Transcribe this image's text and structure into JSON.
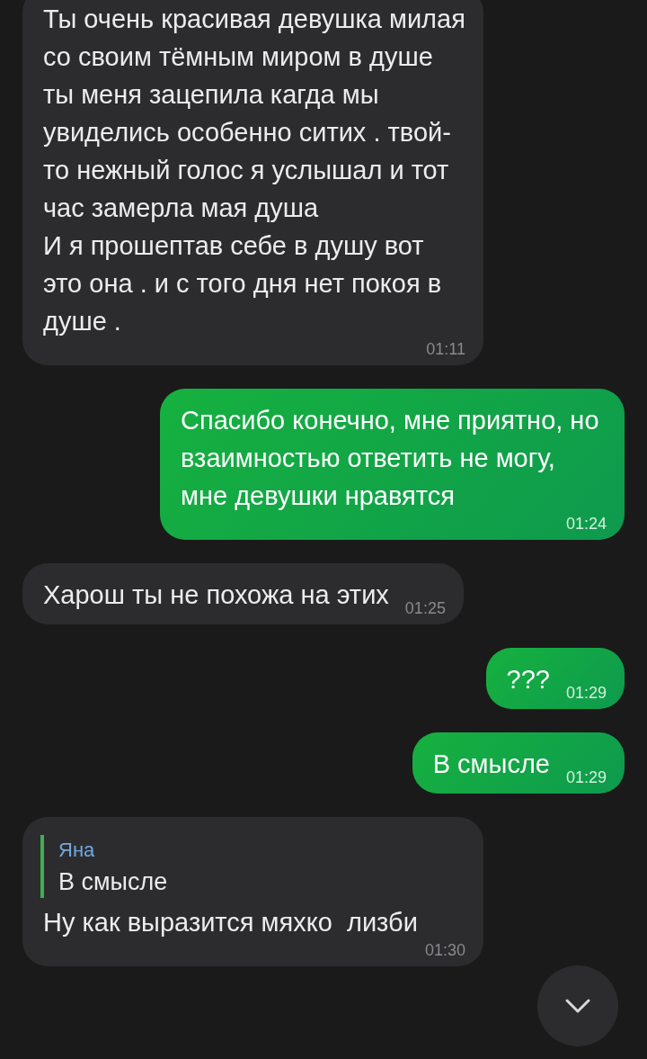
{
  "messages": [
    {
      "kind": "in",
      "text": "Ты очень красивая девушка милая со своим тёмным миром в душе ты меня зацепила кагда мы увиделись особенно ситих . твой-то нежный голос я услышал и тот час замерла мая душа\nИ я прошептав себе в душу вот это она . и с того дня нет покоя в душе .",
      "time": "01:11"
    },
    {
      "kind": "out",
      "text": "Спасибо конечно, мне приятно, но взаимностью ответить не могу, мне девушки нравятся",
      "time": "01:24"
    },
    {
      "kind": "in",
      "text": "Харош ты не похожа на этих",
      "time": "01:25"
    },
    {
      "kind": "out",
      "text": "???",
      "time": "01:29"
    },
    {
      "kind": "out",
      "text": "В смысле",
      "time": "01:29"
    },
    {
      "kind": "in",
      "reply": {
        "author": "Яна",
        "text": "В смысле"
      },
      "text": "Ну как выразится мяхко  лизби",
      "time": "01:30"
    }
  ]
}
